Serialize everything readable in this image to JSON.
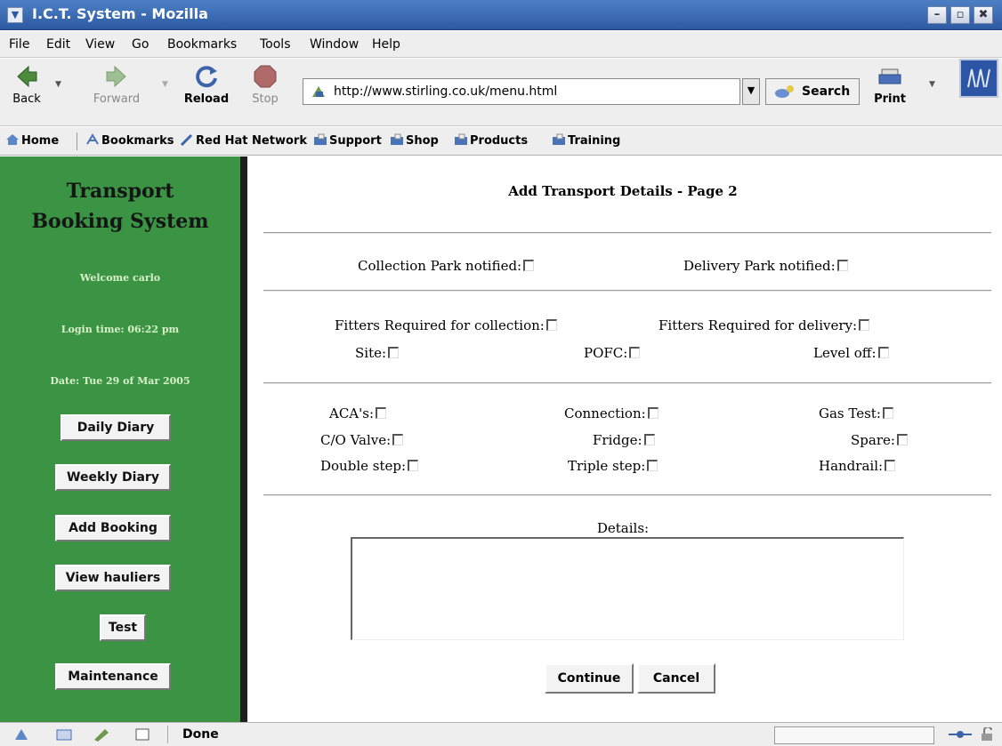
{
  "window": {
    "title": "I.C.T. System - Mozilla",
    "sysmenu_glyph": "▼",
    "min_glyph": "–",
    "max_glyph": "▫",
    "close_glyph": "✖"
  },
  "menubar": {
    "items": [
      "File",
      "Edit",
      "View",
      "Go",
      "Bookmarks",
      "Tools",
      "Window",
      "Help"
    ]
  },
  "navbar": {
    "back_label": "Back",
    "forward_label": "Forward",
    "reload_label": "Reload",
    "stop_label": "Stop",
    "print_label": "Print",
    "url": "http://www.stirling.co.uk/menu.html",
    "search_label": "Search"
  },
  "personal_toolbar": {
    "items": [
      "Home",
      "Bookmarks",
      "Red Hat Network",
      "Support",
      "Shop",
      "Products",
      "Training"
    ]
  },
  "sidebar": {
    "title_line1": "Transport",
    "title_line2": "Booking System",
    "welcome": "Welcome carlo",
    "login_time": "Login time: 06:22 pm",
    "date": "Date: Tue 29 of Mar 2005",
    "buttons": [
      "Daily Diary",
      "Weekly Diary",
      "Add Booking",
      "View hauliers",
      "Test",
      "Maintenance"
    ]
  },
  "form": {
    "heading": "Add Transport Details - Page 2",
    "collection_park": "Collection Park notified:",
    "delivery_park": "Delivery Park notified:",
    "fitters_collection": "Fitters Required for collection:",
    "fitters_delivery": "Fitters Required for delivery:",
    "site": "Site:",
    "pofc": "POFC:",
    "level_off": "Level off:",
    "acas": "ACA's:",
    "connection": "Connection:",
    "gas_test": "Gas Test:",
    "co_valve": "C/O Valve:",
    "fridge": "Fridge:",
    "spare": "Spare:",
    "double_step": "Double step:",
    "triple_step": "Triple step:",
    "handrail": "Handrail:",
    "details_label": "Details:",
    "details_value": "",
    "continue_label": "Continue",
    "cancel_label": "Cancel"
  },
  "statusbar": {
    "text": "Done"
  },
  "colors": {
    "sidebar_bg": "#3a9443",
    "titlebar": "#2c5aa3"
  }
}
